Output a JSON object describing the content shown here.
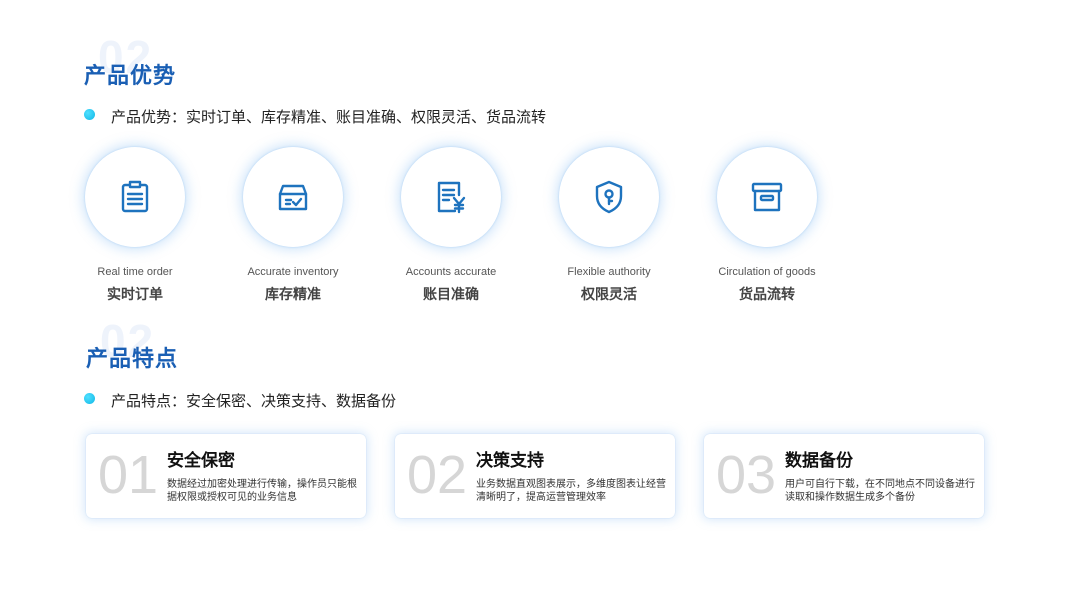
{
  "section1": {
    "ghost": "02",
    "title": "产品优势",
    "bullet": "产品优势：实时订单、库存精准、账目准确、权限灵活、货品流转"
  },
  "advantages": [
    {
      "icon": "clipboard-icon",
      "en": "Real time order",
      "cn": "实时订单"
    },
    {
      "icon": "inventory-box-icon",
      "en": "Accurate inventory",
      "cn": "库存精准"
    },
    {
      "icon": "account-document-yen-icon",
      "en": "Accounts accurate",
      "cn": "账目准确"
    },
    {
      "icon": "shield-key-icon",
      "en": "Flexible authority",
      "cn": "权限灵活"
    },
    {
      "icon": "archive-box-icon",
      "en": "Circulation of goods",
      "cn": "货品流转"
    }
  ],
  "section2": {
    "ghost": "02",
    "title": "产品特点",
    "bullet": "产品特点：安全保密、决策支持、数据备份"
  },
  "features": [
    {
      "num": "01",
      "title": "安全保密",
      "desc": "数据经过加密处理进行传输，操作员只能根据权限或授权可见的业务信息"
    },
    {
      "num": "02",
      "title": "决策支持",
      "desc": "业务数据直观图表展示，多维度图表让经营清晰明了，提高运营管理效率"
    },
    {
      "num": "03",
      "title": "数据备份",
      "desc": "用户可自行下载，在不同地点不同设备进行读取和操作数据生成多个备份"
    }
  ],
  "colors": {
    "accent": "#1a5fb4",
    "icon": "#1e73be",
    "bullet": "#10b7e6"
  }
}
